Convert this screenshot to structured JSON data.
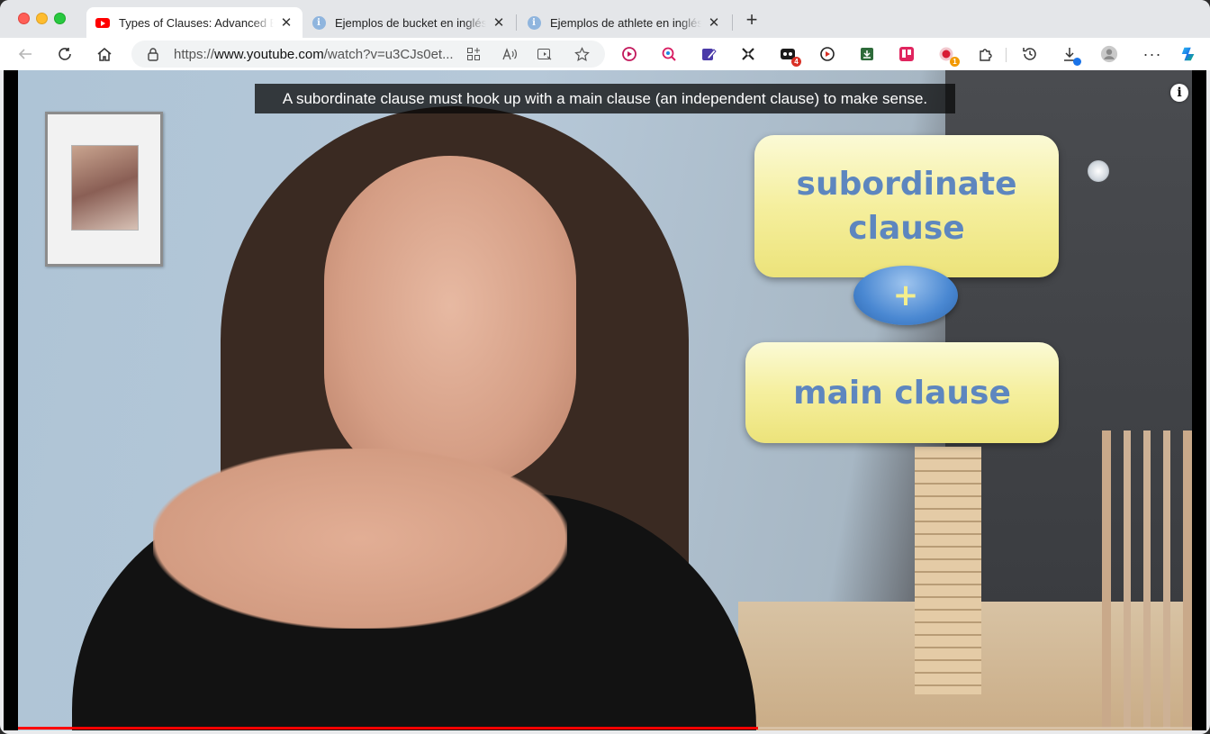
{
  "window": {
    "accent": "#ff0000"
  },
  "tabs": [
    {
      "title": "Types of Clauses: Advanced English",
      "favicon": "youtube-icon",
      "active": true
    },
    {
      "title": "Ejemplos de bucket en inglés | Diccionario",
      "favicon": "info-icon",
      "active": false
    },
    {
      "title": "Ejemplos de athlete en inglés | Diccionario",
      "favicon": "info-icon",
      "active": false
    }
  ],
  "toolbar": {
    "url_prefix": "https://",
    "url_host": "www.youtube.com",
    "url_path": "/watch?v=u3CJs0et...",
    "extensions": [
      {
        "name": "video-extension-icon",
        "badge": ""
      },
      {
        "name": "search-extension-icon",
        "badge": ""
      },
      {
        "name": "edit-extension-icon",
        "badge": ""
      },
      {
        "name": "sparkle-extension-icon",
        "badge": ""
      },
      {
        "name": "game-extension-icon",
        "badge": "4"
      },
      {
        "name": "record-extension-icon",
        "badge": ""
      },
      {
        "name": "download-box-extension-icon",
        "badge": ""
      },
      {
        "name": "trello-extension-icon",
        "badge": ""
      },
      {
        "name": "red-dot-extension-icon",
        "badge": "1"
      }
    ]
  },
  "video": {
    "caption": "A subordinate clause must hook up with a main clause (an independent clause) to make sense.",
    "info_label": "i",
    "slide": {
      "top_line1": "subordinate",
      "top_line2": "clause",
      "plus": "+",
      "bottom": "main clause"
    },
    "progress_fraction": 0.63
  }
}
